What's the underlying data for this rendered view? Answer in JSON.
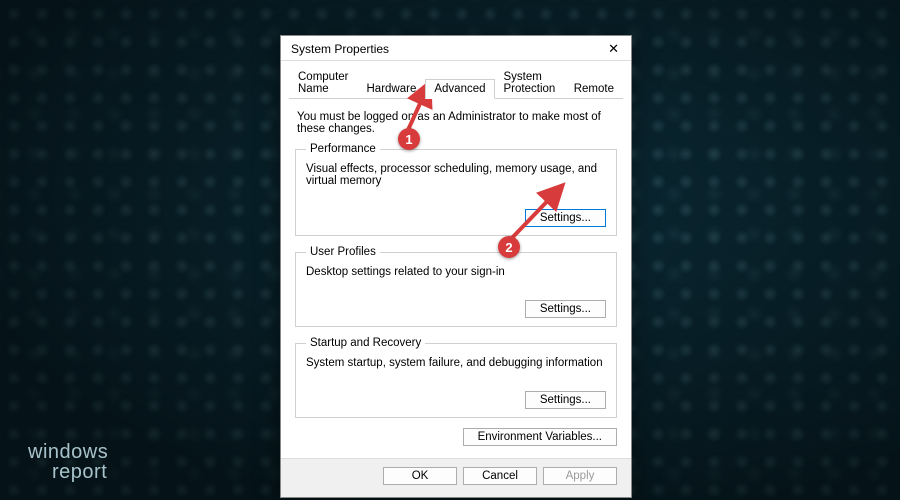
{
  "watermark": {
    "line1": "windows",
    "line2": "report"
  },
  "window": {
    "title": "System Properties"
  },
  "tabs": [
    {
      "label": "Computer Name"
    },
    {
      "label": "Hardware"
    },
    {
      "label": "Advanced"
    },
    {
      "label": "System Protection"
    },
    {
      "label": "Remote"
    }
  ],
  "admin_note": "You must be logged on as an Administrator to make most of these changes.",
  "groups": {
    "performance": {
      "legend": "Performance",
      "desc": "Visual effects, processor scheduling, memory usage, and virtual memory",
      "button": "Settings..."
    },
    "profiles": {
      "legend": "User Profiles",
      "desc": "Desktop settings related to your sign-in",
      "button": "Settings..."
    },
    "startup": {
      "legend": "Startup and Recovery",
      "desc": "System startup, system failure, and debugging information",
      "button": "Settings..."
    }
  },
  "env_button": "Environment Variables...",
  "footer": {
    "ok": "OK",
    "cancel": "Cancel",
    "apply": "Apply"
  },
  "annotations": {
    "badge1": "1",
    "badge2": "2"
  }
}
